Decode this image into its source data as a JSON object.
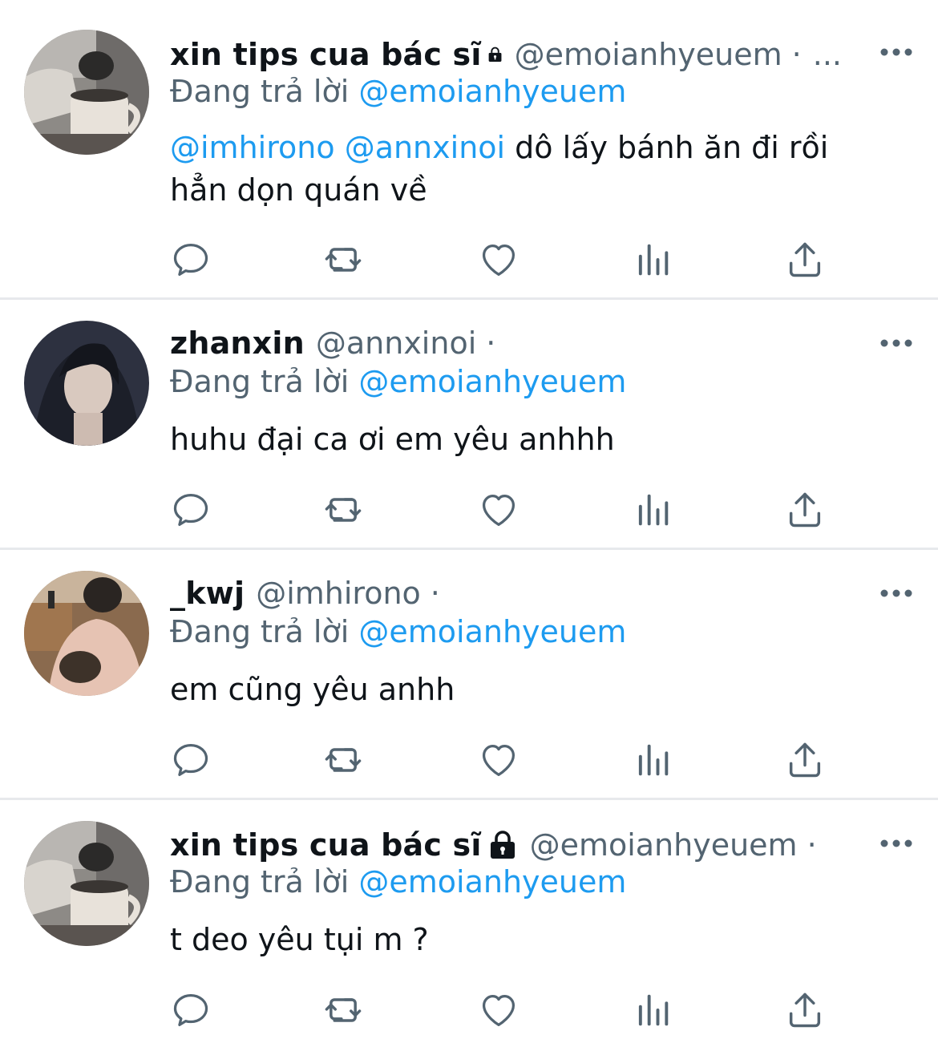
{
  "tweets": [
    {
      "display_name": "xin tips cua bác sĩ",
      "locked": true,
      "handle": "@emoianhyeuem",
      "dot": "·",
      "trail": "...",
      "reply_prefix": "Đang trả lời",
      "reply_to": "@emoianhyeuem",
      "mention_1": "@imhirono",
      "mention_2": "@annxinoi",
      "text_1": "dô lấy bánh ăn đi rồi",
      "text_2": "hẳn dọn quán về",
      "avatar": "man-leaning-over-cup-avatar"
    },
    {
      "display_name": "zhanxin",
      "locked": false,
      "handle": "@annxinoi",
      "dot": "·",
      "reply_prefix": "Đang trả lời",
      "reply_to": "@emoianhyeuem",
      "text": "huhu đại ca ơi em yêu anhhh",
      "avatar": "dark-hair-portrait-avatar"
    },
    {
      "display_name": "_kwj",
      "locked": false,
      "handle": "@imhirono",
      "dot": "·",
      "reply_prefix": "Đang trả lời",
      "reply_to": "@emoianhyeuem",
      "text": "em cũng yêu anhh",
      "avatar": "person-holding-pet-avatar"
    },
    {
      "display_name": "xin tips cua bác sĩ",
      "locked": true,
      "handle": "@emoianhyeuem",
      "dot": "·",
      "reply_prefix": "Đang trả lời",
      "reply_to": "@emoianhyeuem",
      "text": "t deo yêu tụi m ?",
      "avatar": "man-leaning-over-cup-avatar"
    }
  ],
  "icons": {
    "reply": "reply-icon",
    "retweet": "retweet-icon",
    "like": "heart-icon",
    "views": "analytics-icon",
    "share": "share-icon",
    "more": "more-icon",
    "lock": "lock-icon"
  },
  "colors": {
    "text": "#0f1419",
    "secondary": "#536471",
    "accent": "#1d9bf0",
    "divider": "#e7e9ec"
  }
}
